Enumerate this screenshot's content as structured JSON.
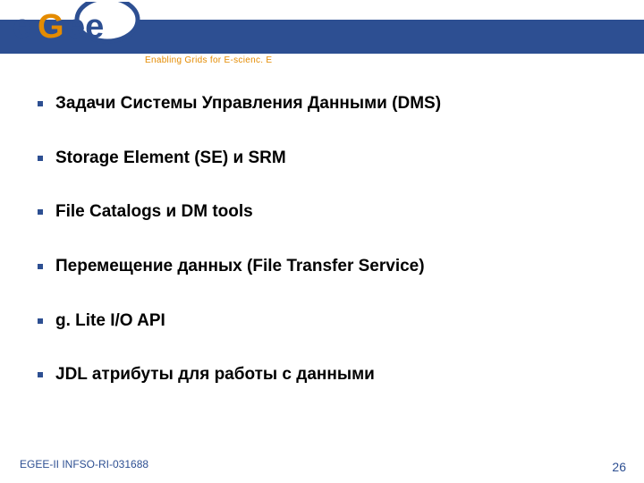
{
  "header": {
    "tagline": "Enabling Grids for E-scienc. E",
    "logo_text": "eGee"
  },
  "bullets": [
    {
      "text": "Задачи Системы Управления Данными (DMS)"
    },
    {
      "text": "Storage Element (SE) и SRM"
    },
    {
      "text": "File Catalogs и DM tools"
    },
    {
      "text": "Перемещение данных (File Transfer Service)"
    },
    {
      "text": "g. Lite I/O API"
    },
    {
      "text": "JDL атрибуты для работы с данными"
    }
  ],
  "footer": {
    "left": "EGEE-II INFSO-RI-031688",
    "page": "26"
  },
  "colors": {
    "banner": "#2d4f92",
    "accent": "#e48b00"
  }
}
